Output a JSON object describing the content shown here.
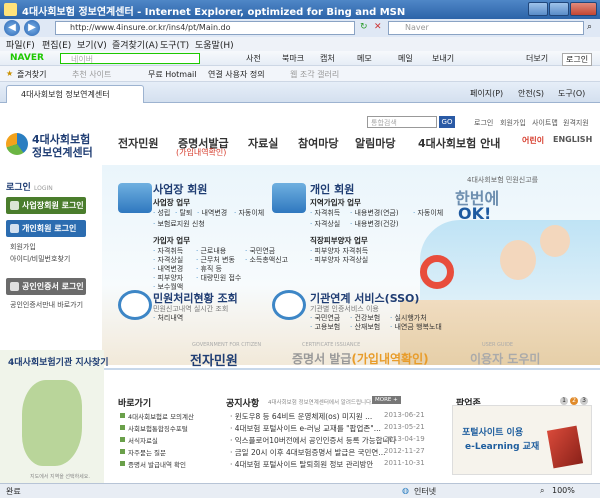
{
  "window": {
    "title": "4대사회보험 정보연계센터 - Internet Explorer, optimized for Bing and MSN"
  },
  "addressbar": {
    "url": "http://www.4insure.or.kr/ins4/pt/Main.do",
    "search_placeholder": "Naver"
  },
  "menu": [
    "파일(F)",
    "편집(E)",
    "보기(V)",
    "즐겨찾기(A)",
    "도구(T)",
    "도움말(H)"
  ],
  "naver_toolbar": {
    "brand": "NAVER",
    "search_placeholder": "네이버",
    "items": [
      "사전",
      "북마크",
      "캡처",
      "메모",
      "메일",
      "보내기"
    ],
    "more": "더보기",
    "login": "로그인"
  },
  "favorites": {
    "label": "즐겨찾기",
    "items": [
      "추천 사이트",
      "무료 Hotmail",
      "연결 사용자 정의",
      "웹 조각 갤러리"
    ]
  },
  "tab": {
    "label": "4대사회보험 정보연계센터"
  },
  "commandbar": [
    "페이지(P)",
    "안전(S)",
    "도구(O)"
  ],
  "site": {
    "logo_line1": "4대사회보험",
    "logo_line2": "정보연계센터",
    "search_placeholder": "통합검색",
    "search_btn": "GO",
    "util_links": [
      "로그인",
      "회원가입",
      "사이트맵",
      "원격지원"
    ],
    "gnb": [
      "전자민원",
      "증명서발급",
      "자료실",
      "참여마당",
      "알림마당",
      "4대사회보험 안내"
    ],
    "gnb_sub": "(가입내역확인)",
    "lang": [
      "어린이",
      "ENGLISH"
    ]
  },
  "login_panel": {
    "title": "로그인",
    "title_en": "LOGIN",
    "business_login": "사업장회원 로그인",
    "personal_login": "개인회원 로그인",
    "join": "회원가입",
    "find": "아이디/비밀번호찾기",
    "cert_login": "공인인증서 로그인",
    "cert_note": "공인인증서만내 바로가기"
  },
  "hero": {
    "tagline": "4대사회보험 민원신고를",
    "big1": "한번에",
    "big2": "OK!"
  },
  "services": {
    "business": {
      "title": "사업장 회원",
      "sub": "사업장 업무",
      "row1": [
        "성립",
        "탈퇴",
        "내역변경",
        "자동이체"
      ],
      "row2": [
        "보험료지원 신청"
      ],
      "sub2": "가입자 업무",
      "col1": [
        "자격취득",
        "자격상실",
        "내역변경",
        "피부양자",
        "보수월액"
      ],
      "col2": [
        "근로내용",
        "근무처 변동",
        "휴직 등",
        "대량민원 접수"
      ],
      "col3": [
        "국민연금",
        "소득총액신고"
      ]
    },
    "personal": {
      "title": "개인 회원",
      "sub": "지역가입자 업무",
      "row1": [
        "자격취득",
        "내용변경(연금)",
        "자동이체"
      ],
      "row2": [
        "자격상실",
        "내용변경(건강)"
      ],
      "sub2": "직장피부양자 업무",
      "row3": [
        "피부양자 자격취득"
      ],
      "row4": [
        "피부양자 자격상실"
      ]
    },
    "status": {
      "title": "민원처리현황 조회",
      "sub": "민원신고내역 실시간 조회",
      "item": "처리내역"
    },
    "sso": {
      "title": "기관연계 서비스(SSO)",
      "sub": "기관별 인증서비스 이용",
      "row1": [
        "국민연금",
        "건강보험",
        "실시행가처"
      ],
      "row2": [
        "고용보험",
        "산재보험",
        "내연금 행복노대"
      ]
    }
  },
  "bottom_tabs": {
    "left": "전자민원",
    "left_small": "GOVERNMENT FOR CITIZEN",
    "mid": "증명서 발급",
    "mid_hl": "(가입내역확인)",
    "mid_small": "CERTIFICATE ISSUANCE",
    "right": "이용자 도우미",
    "right_small": "USER GUIDE"
  },
  "branch_map": {
    "title": "4대사회보험기관 지사찾기",
    "note": "지도에서 지역을 선택하세요."
  },
  "quick": {
    "title": "바로가기",
    "items": [
      "4대사회보험료 모의계산",
      "사회보험통합징수포털",
      "서식자료실",
      "자주묻는 질문",
      "증명서 발급내역 확인"
    ]
  },
  "notice": {
    "title": "공지사항",
    "desc": "4대사회보험 정보연계센터에서 알려드립니다.",
    "more": "MORE +",
    "items": [
      {
        "text": "윈도우8 등 64비트 운영체제(os) 미지원 ...",
        "date": "2013-06-21"
      },
      {
        "text": "4대보험 포털사이트 e-러닝 교재를 \"팝업존\"...",
        "date": "2013-05-21"
      },
      {
        "text": "익스플로어10버전에서 공인인증서 등록 가능합니다",
        "date": "2013-04-19"
      },
      {
        "text": "금일 20시 이후 4대보험증명서 발급은 국민연...",
        "date": "2012-11-27"
      },
      {
        "text": "4대보험 포털사이트 탈퇴회원 정보 관리방안",
        "date": "2011-10-31"
      }
    ]
  },
  "popup": {
    "title": "팝업존",
    "line1": "포털사이트 이용",
    "line2": "e-Learning 교재",
    "pages": [
      "1",
      "2",
      "3"
    ]
  },
  "status": {
    "left": "완료",
    "zone": "인터넷",
    "zoom": "100%"
  }
}
